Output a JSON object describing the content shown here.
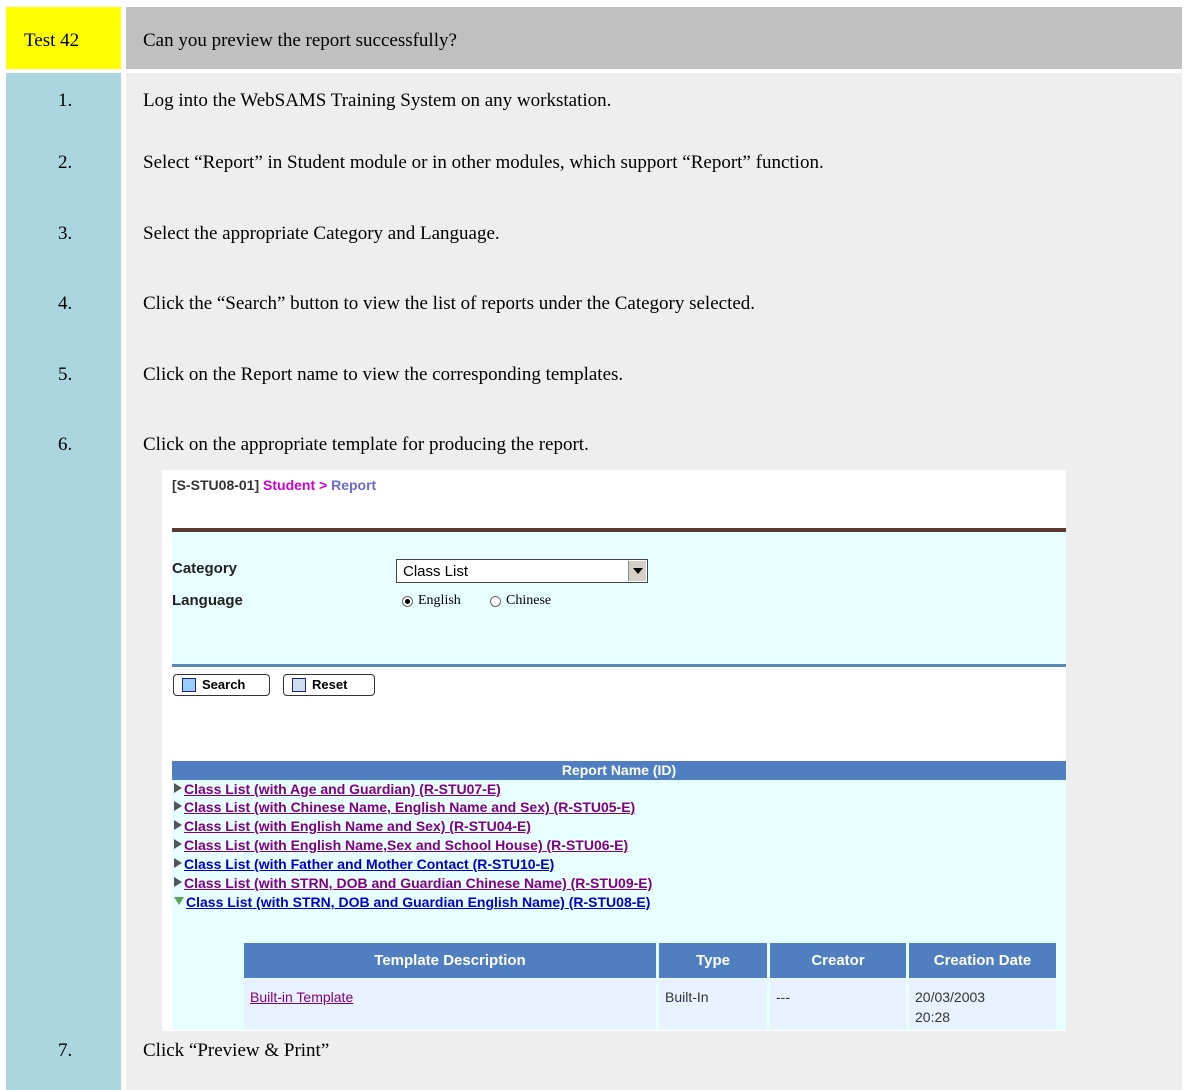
{
  "test": {
    "label": "Test 42",
    "question": "Can you preview the report successfully?"
  },
  "steps": [
    {
      "num": "1.",
      "text": "Log into the WebSAMS Training System on any workstation."
    },
    {
      "num": "2.",
      "text": "Select “Report” in Student module or in other modules, which support “Report” function."
    },
    {
      "num": "3.",
      "text": "Select the appropriate Category and Language."
    },
    {
      "num": "4.",
      "text": "Click the “Search” button to view the list of reports under the Category selected."
    },
    {
      "num": "5.",
      "text": "Click on the Report name to view the corresponding templates."
    },
    {
      "num": "6.",
      "text": "Click on the appropriate template for producing the report."
    },
    {
      "num": "7.",
      "text": "Click “Preview & Print”"
    }
  ],
  "screenshot": {
    "breadcrumb": {
      "code": "[S-STU08-01]",
      "module": "Student",
      "separator": ">",
      "page": "Report"
    },
    "category_label": "Category",
    "category_value": "Class List",
    "language_label": "Language",
    "language_options": [
      "English",
      "Chinese"
    ],
    "language_selected": "English",
    "buttons": {
      "search": "Search",
      "reset": "Reset"
    },
    "report_header": "Report Name (ID)",
    "reports": [
      {
        "name": "Class List (with Age and Guardian) (R-STU07-E)",
        "visited": true
      },
      {
        "name": "Class List (with Chinese Name, English Name and Sex) (R-STU05-E)",
        "visited": true
      },
      {
        "name": "Class List (with English Name and Sex) (R-STU04-E)",
        "visited": true
      },
      {
        "name": "Class List (with English Name,Sex and School House) (R-STU06-E)",
        "visited": true
      },
      {
        "name": "Class List (with Father and Mother Contact (R-STU10-E)",
        "visited": false
      },
      {
        "name": "Class List (with STRN, DOB and Guardian Chinese Name) (R-STU09-E)",
        "visited": true
      },
      {
        "name": "Class List (with STRN, DOB and Guardian English Name) (R-STU08-E)",
        "visited": false,
        "expanded": true
      }
    ],
    "template_table": {
      "headers": [
        "Template Description",
        "Type",
        "Creator",
        "Creation Date"
      ],
      "row": {
        "description": "Built-in Template",
        "type": "Built-In",
        "creator": "---",
        "date": "20/03/2003",
        "time": "20:28"
      }
    }
  },
  "colors": {
    "header_yellow": "#ffff00",
    "header_grey": "#c0c0c0",
    "number_column": "#a9d6df",
    "body": "#eeeeee",
    "table_blue": "#4f7fc0"
  }
}
